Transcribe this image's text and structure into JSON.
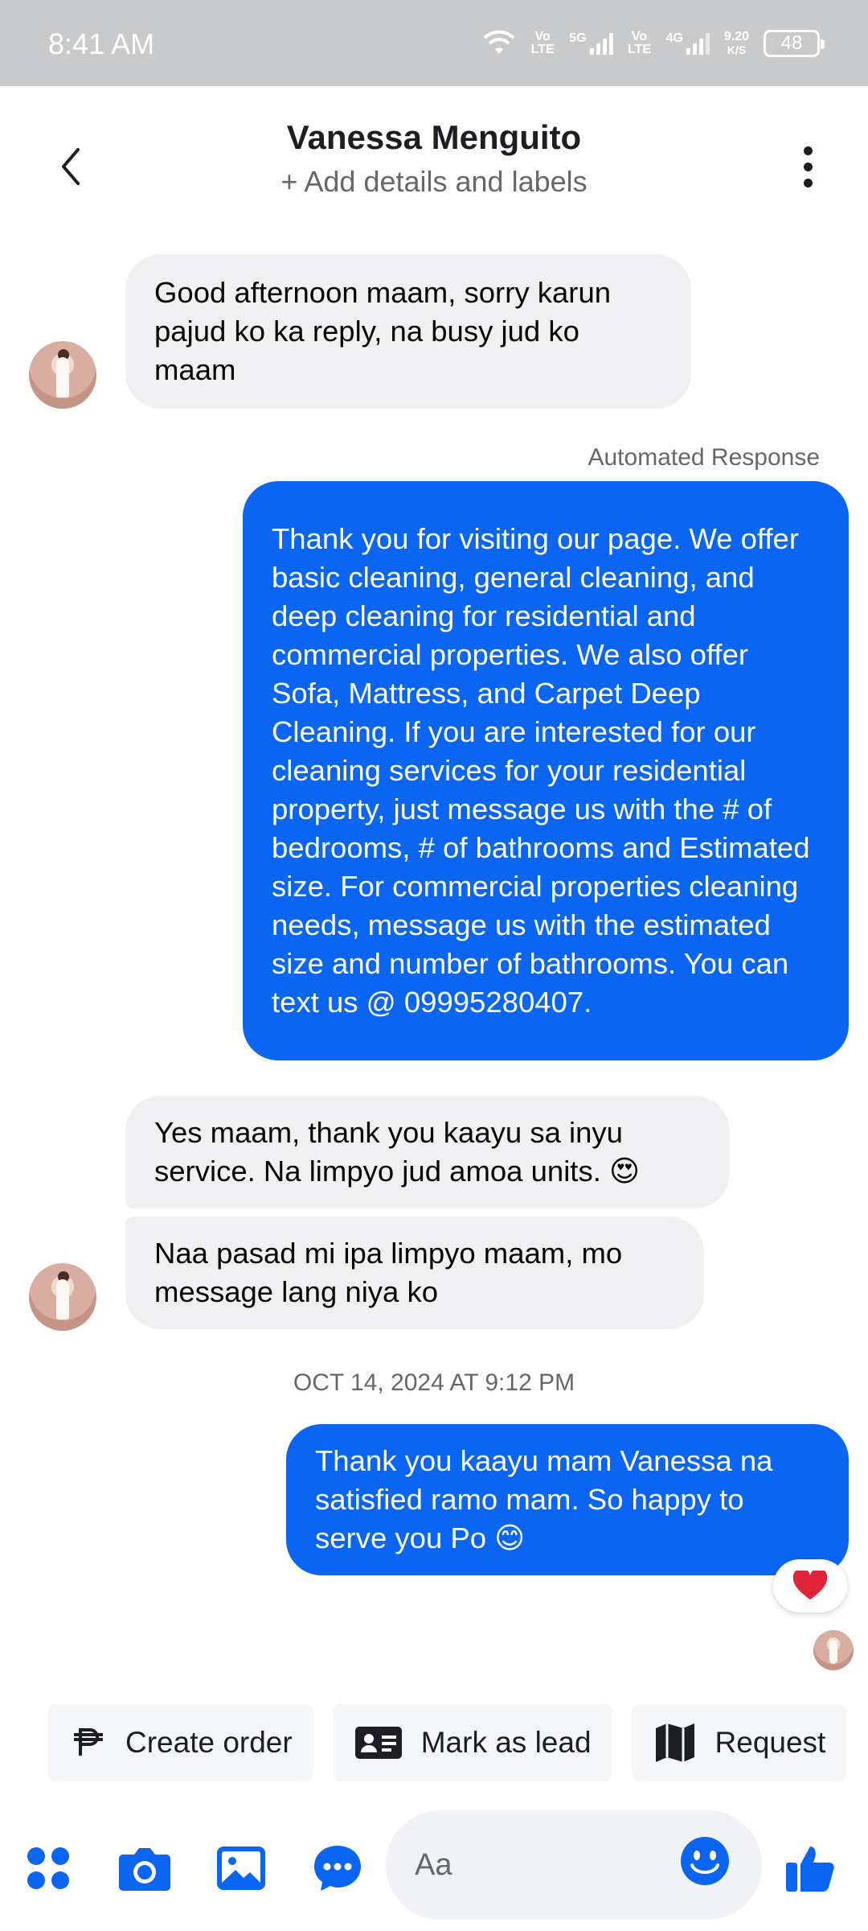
{
  "status_bar": {
    "time": "8:41 AM",
    "volte1": "Vo LTE",
    "net1": "5G",
    "volte2": "Vo LTE",
    "net2": "4G",
    "speed_value": "9.20",
    "speed_unit": "K/S",
    "battery": "48"
  },
  "header": {
    "title": "Vanessa Menguito",
    "subtitle": "+ Add details and labels"
  },
  "messages": [
    {
      "sender": "contact",
      "text": "Good afternoon maam, sorry karun pajud ko ka reply, na busy jud ko maam"
    },
    {
      "sender": "page",
      "label": "Automated Response",
      "text": "Thank you for visiting our page. We offer basic cleaning, general cleaning, and deep cleaning for residential and commercial properties. We also offer Sofa, Mattress, and Carpet Deep Cleaning. If you are interested for our cleaning services for your residential property, just message us with the # of bedrooms, # of bathrooms and Estimated size. For commercial properties cleaning needs, message us with the estimated size and number of bathrooms. You can text us @ 09995280407."
    },
    {
      "sender": "contact",
      "text": "Yes maam, thank you kaayu sa inyu service. Na limpyo jud amoa units. 😍"
    },
    {
      "sender": "contact",
      "text": "Naa pasad mi ipa limpyo maam, mo message lang niya ko"
    },
    {
      "sender": "page",
      "text": "Thank you kaayu mam Vanessa na satisfied ramo mam. So happy to serve you Po 😊",
      "reaction": "heart"
    }
  ],
  "timestamp": "OCT 14, 2024 AT 9:12 PM",
  "quick_actions": [
    {
      "label": "Create order",
      "icon": "peso-icon"
    },
    {
      "label": "Mark as lead",
      "icon": "id-card-icon"
    },
    {
      "label": "Request",
      "icon": "map-icon"
    }
  ],
  "composer": {
    "placeholder": "Aa",
    "icons": [
      "apps-icon",
      "camera-icon",
      "gallery-icon",
      "chat-bubble-icon",
      "smiley-icon",
      "thumbs-up-icon"
    ]
  },
  "colors": {
    "accent": "#0a66f2",
    "incoming_bubble": "#f0f0f2",
    "status_bar": "#c9cacc",
    "reaction_heart": "#e0243a"
  }
}
